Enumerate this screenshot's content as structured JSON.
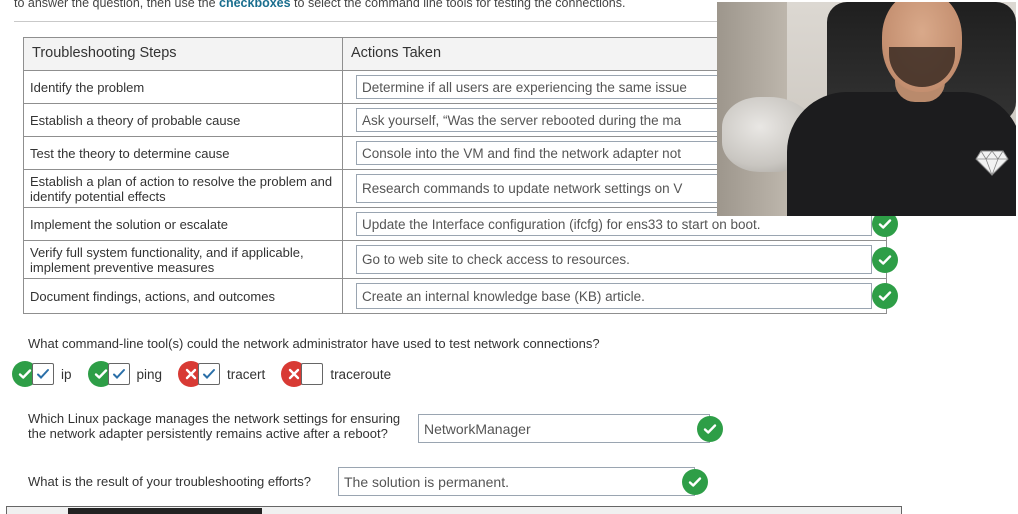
{
  "intro": {
    "prefix": "to answer the question, then use the ",
    "keyword": "checkboxes",
    "suffix": " to select the command line tools for testing the connections."
  },
  "table": {
    "headers": [
      "Troubleshooting Steps",
      "Actions Taken"
    ],
    "rows": [
      {
        "step": "Identify the problem",
        "action": "Determine if all users are experiencing the same issue"
      },
      {
        "step": "Establish a theory of probable cause",
        "action": "Ask yourself, “Was the server rebooted during the ma"
      },
      {
        "step": "Test the theory to determine cause",
        "action": "Console into the VM and find the network adapter not"
      },
      {
        "step": "Establish a plan of action to resolve the problem and identify potential effects",
        "action": "Research commands to update network settings on V"
      },
      {
        "step": "Implement the solution or escalate",
        "action": "Update the Interface configuration (ifcfg) for ens33 to start on boot."
      },
      {
        "step": "Verify full system functionality, and if applicable, implement preventive measures",
        "action": "Go to web site to check access to resources."
      },
      {
        "step": "Document findings, actions, and outcomes",
        "action": "Create an internal knowledge base (KB) article."
      }
    ]
  },
  "q1": {
    "text": "What command-line tool(s) could the network administrator have used to test network connections?",
    "tools": [
      {
        "label": "ip",
        "result": "correct"
      },
      {
        "label": "ping",
        "result": "correct"
      },
      {
        "label": "tracert",
        "result": "incorrect"
      },
      {
        "label": "traceroute",
        "result": "incorrect"
      }
    ]
  },
  "q2": {
    "text": "Which Linux package manages the network settings for ensuring the network adapter persistently remains active after a reboot?",
    "answer": "NetworkManager"
  },
  "q3": {
    "text": "What is the result of your troubleshooting efforts?",
    "answer": "The solution is permanent."
  },
  "colors": {
    "correct": "#2e9e47",
    "incorrect": "#d83a34",
    "keyword": "#1a6e8e"
  }
}
